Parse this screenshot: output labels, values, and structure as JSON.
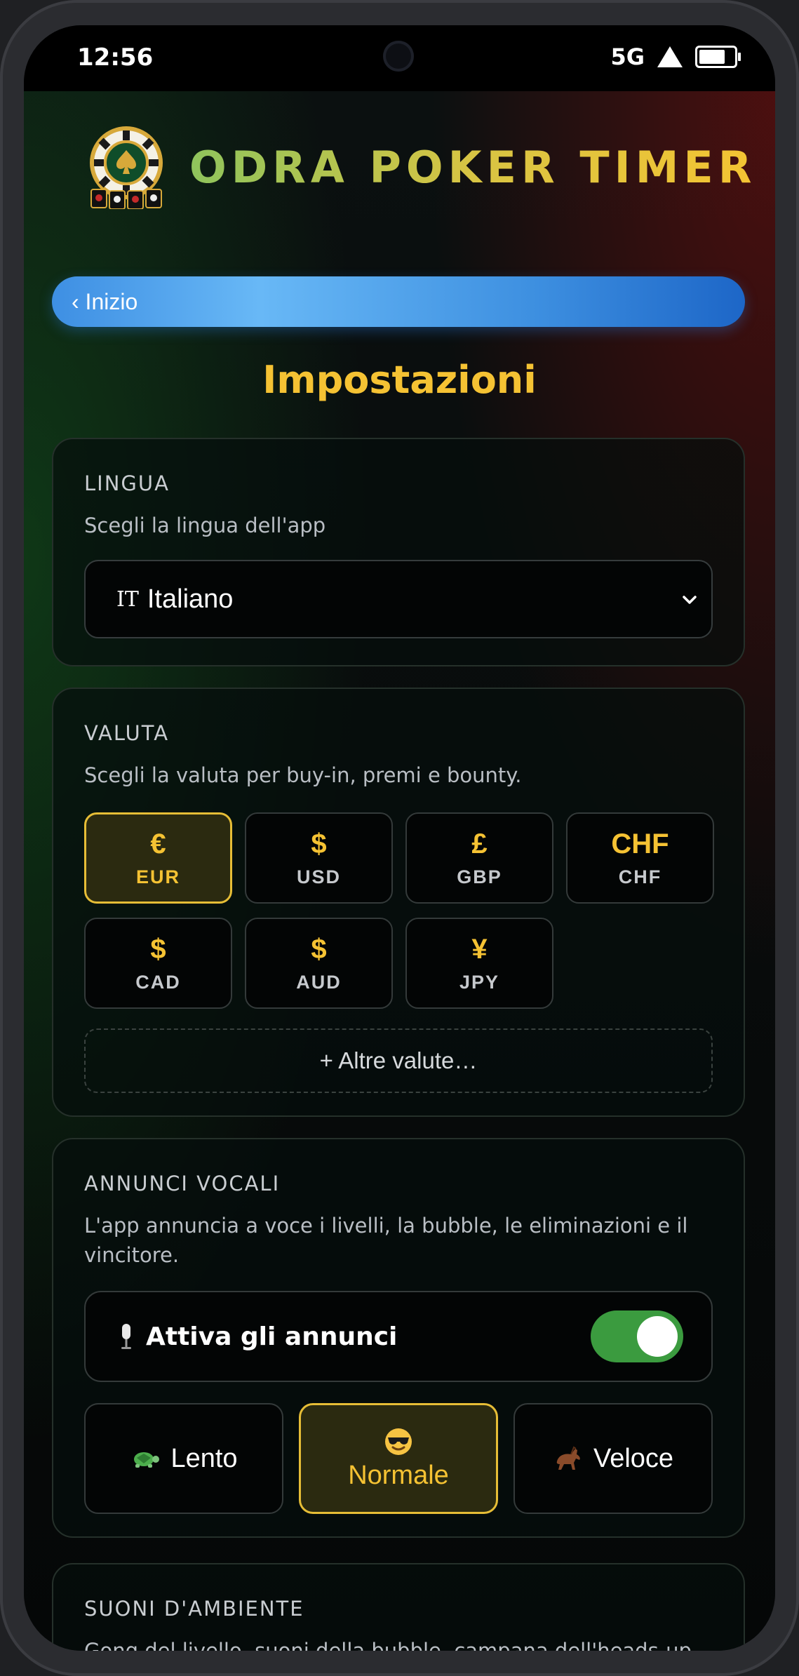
{
  "status_bar": {
    "time": "12:56",
    "network": "5G"
  },
  "header": {
    "app_title": "ODRA POKER TIMER"
  },
  "nav": {
    "back_label": "‹ Inizio"
  },
  "page": {
    "title": "Impostazioni"
  },
  "language": {
    "title": "LINGUA",
    "description": "Scegli la lingua dell'app",
    "selected_flag": "IT",
    "selected_value": "Italiano"
  },
  "currency": {
    "title": "VALUTA",
    "description": "Scegli la valuta per buy-in, premi e bounty.",
    "options": [
      {
        "symbol": "€",
        "code": "EUR"
      },
      {
        "symbol": "$",
        "code": "USD"
      },
      {
        "symbol": "£",
        "code": "GBP"
      },
      {
        "symbol": "CHF",
        "code": "CHF"
      },
      {
        "symbol": "$",
        "code": "CAD"
      },
      {
        "symbol": "$",
        "code": "AUD"
      },
      {
        "symbol": "¥",
        "code": "JPY"
      }
    ],
    "selected": "EUR",
    "more_label": "+ Altre valute…"
  },
  "voice": {
    "title": "ANNUNCI VOCALI",
    "description": "L'app annuncia a voce i livelli, la bubble, le eliminazioni e il vincitore.",
    "toggle_label": "Attiva gli annunci",
    "toggle_on": true,
    "speeds": [
      {
        "icon": "turtle-icon",
        "label": "Lento"
      },
      {
        "icon": "sunglasses-face-icon",
        "label": "Normale"
      },
      {
        "icon": "horse-icon",
        "label": "Veloce"
      }
    ],
    "selected_speed": "Normale"
  },
  "ambient": {
    "title": "SUONI D'AMBIENTE",
    "description": "Gong del livello, suoni della bubble, campana dell'heads-up, applausi e jackpot del vincitore. Disattiva se ascolti musica."
  },
  "colors": {
    "accent": "#f5c233",
    "toggle": "#3b9b3f",
    "back_button": "#4a9ae8"
  }
}
